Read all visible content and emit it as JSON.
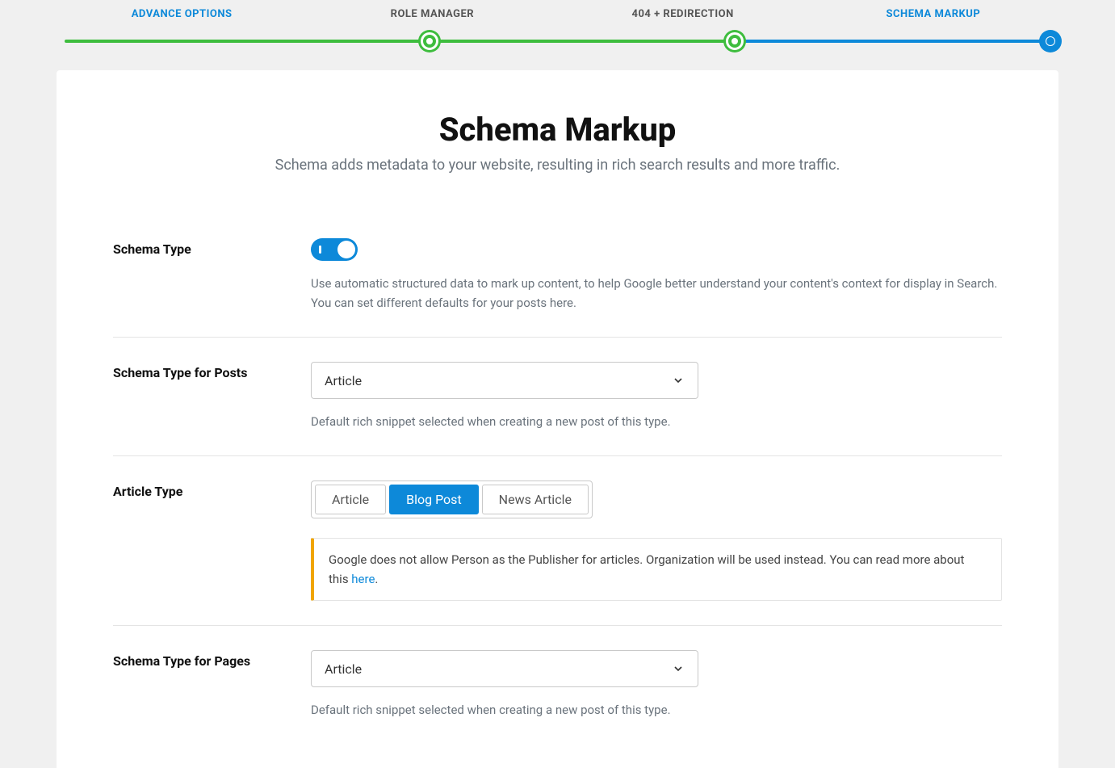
{
  "stepper": {
    "items": [
      {
        "label": "ADVANCE OPTIONS",
        "active": true
      },
      {
        "label": "ROLE MANAGER",
        "active": false
      },
      {
        "label": "404 + REDIRECTION",
        "active": false
      },
      {
        "label": "SCHEMA MARKUP",
        "active": true
      }
    ]
  },
  "header": {
    "title": "Schema Markup",
    "subtitle": "Schema adds metadata to your website, resulting in rich search results and more traffic."
  },
  "fields": {
    "schema_type": {
      "label": "Schema Type",
      "toggle_on": true,
      "help": "Use automatic structured data to mark up content, to help Google better understand your content's context for display in Search. You can set different defaults for your posts here."
    },
    "schema_posts": {
      "label": "Schema Type for Posts",
      "selected": "Article",
      "help": "Default rich snippet selected when creating a new post of this type."
    },
    "article_type": {
      "label": "Article Type",
      "options": [
        "Article",
        "Blog Post",
        "News Article"
      ],
      "selected_index": 1,
      "notice_text": "Google does not allow Person as the Publisher for articles. Organization will be used instead. You can read more about this ",
      "notice_link": "here",
      "notice_suffix": "."
    },
    "schema_pages": {
      "label": "Schema Type for Pages",
      "selected": "Article",
      "help": "Default rich snippet selected when creating a new post of this type."
    }
  },
  "colors": {
    "accent_blue": "#0d89d9",
    "accent_green": "#3ebd3e",
    "notice_border": "#f0a500"
  }
}
